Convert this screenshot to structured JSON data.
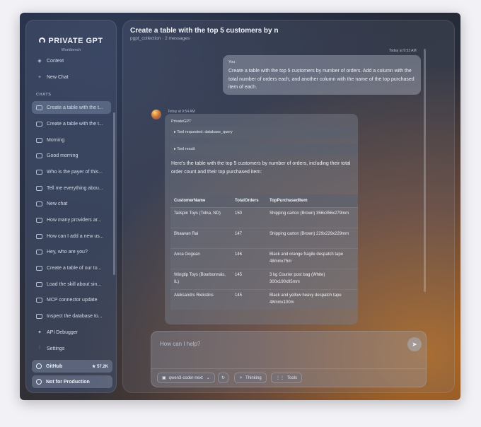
{
  "sidebar": {
    "brand": "PRIVATE GPT",
    "brand_sub": "Workbench",
    "nav": [
      {
        "icon": "layers-icon",
        "label": "Context"
      },
      {
        "icon": "plus-icon",
        "label": "New Chat"
      }
    ],
    "section_label": "CHATS",
    "chats": [
      "Create a table with the t...",
      "Create a table with the t...",
      "Morning",
      "Good morning",
      "Who is the payer of this...",
      "Tell me everything abou...",
      "New chat",
      "How many providers ar...",
      "How can I add a new us...",
      "Hey, who are you?",
      "Create a table of our to...",
      "Load the skill about sin...",
      "MCP connector update",
      "Inspect the database to..."
    ],
    "tools": [
      {
        "icon": "debug-icon",
        "label": "API Debugger"
      },
      {
        "icon": "sliders-icon",
        "label": "Settings"
      }
    ],
    "github_label": "GitHub",
    "github_stars": "★ 57.2K",
    "not_for_production": "Not for Production"
  },
  "header": {
    "title": "Create a table with the top 5 customers by n",
    "subtitle": "pgpt_collection · 2 messages"
  },
  "messages": {
    "user": {
      "timestamp": "Today at 9:53 AM",
      "author": "You",
      "text": "Create a table with the top 5 customers by number of orders. Add a column with the total number of orders each, and another column with the name of the top purchased item of each."
    },
    "assistant": {
      "timestamp": "Today at 9:54 AM",
      "author": "PrivateGPT",
      "tool_requested": "▸ Tool requested: database_query",
      "tool_result": "▸ Tool result",
      "intro": "Here's the table with the top 5 customers by number of orders, including their total order count and their top purchased item:",
      "table": {
        "headers": [
          "CustomerName",
          "TotalOrders",
          "TopPurchasedItem"
        ],
        "rows": [
          [
            "Tailspin Toys (Tolna, ND)",
            "150",
            "Shipping carton (Brown) 356x356x279mm"
          ],
          [
            "Bhaavan Rai",
            "147",
            "Shipping carton (Brown) 229x229x229mm"
          ],
          [
            "Anca Gogean",
            "146",
            "Black and orange fragile despatch tape 48mmx75m"
          ],
          [
            "Wingtip Toys (Bourbonnais, IL)",
            "145",
            "3 kg Courier post bag (White) 300x190x95mm"
          ],
          [
            "Aleksandrs Riekstins",
            "145",
            "Black and yellow heavy despatch tape 48mmx100m"
          ]
        ]
      }
    }
  },
  "composer": {
    "placeholder": "How can I help?",
    "model": "qwen3-coder-next",
    "thinking": "Thinking",
    "tools": "Tools"
  }
}
